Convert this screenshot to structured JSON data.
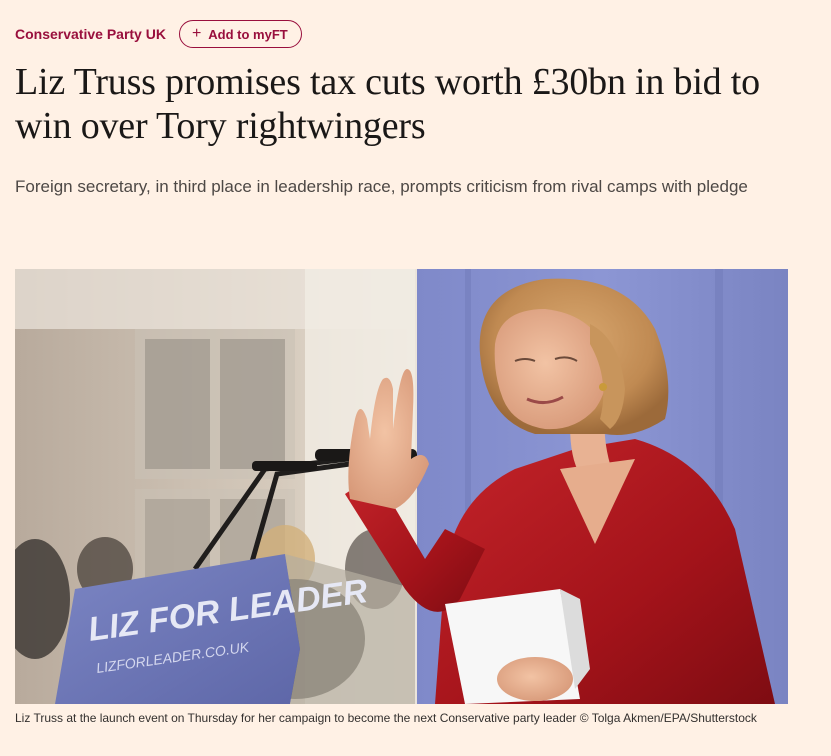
{
  "topic": {
    "label": "Conservative Party UK"
  },
  "myft": {
    "plus": "+",
    "label": "Add to myFT"
  },
  "article": {
    "headline": "Liz Truss promises tax cuts worth £30bn in bid to win over Tory rightwingers",
    "standfirst": "Foreign secretary, in third place in leadership race, prompts criticism from rival camps with pledge",
    "image": {
      "lectern_text": "LIZ FOR LEADER",
      "lectern_url": "LIZFORLEADER.CO.UK"
    },
    "caption": "Liz Truss at the launch event on Thursday for her campaign to become the next Conservative party leader © Tolga Akmen/EPA/Shutterstock"
  },
  "colors": {
    "background": "#fff1e5",
    "accent": "#990f3d",
    "headline": "#1a1817",
    "standfirst": "#4d4845",
    "jacket": "#b3171c"
  }
}
